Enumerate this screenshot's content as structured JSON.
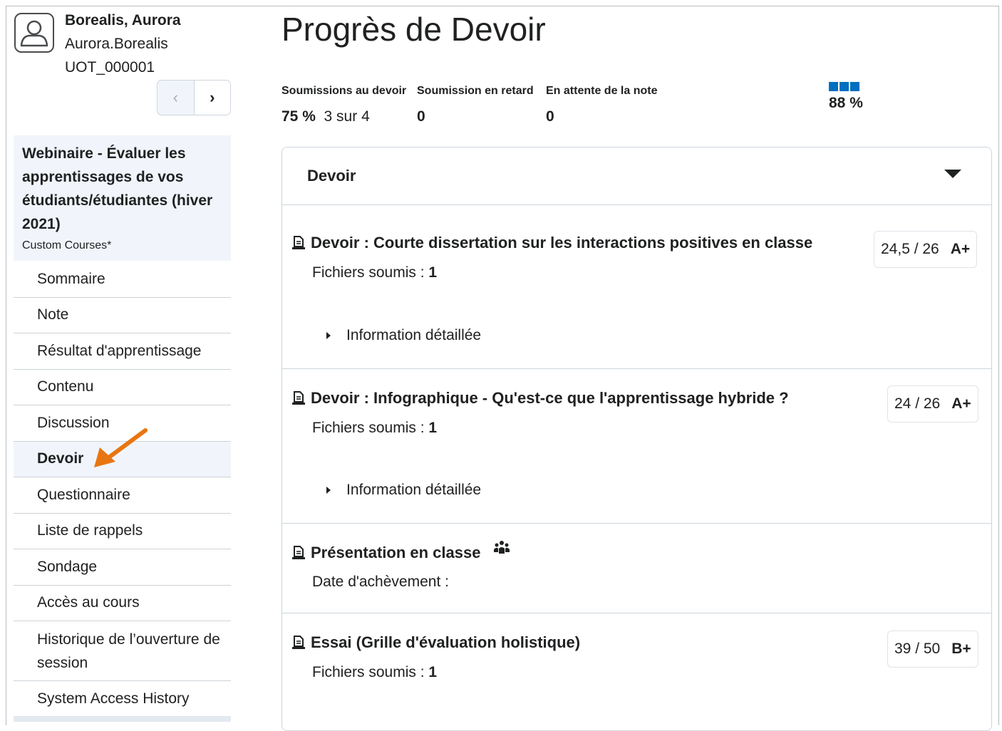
{
  "user": {
    "name": "Borealis, Aurora",
    "login": "Aurora.Borealis",
    "id": "UOT_000001"
  },
  "pager": {
    "prev": "‹",
    "next": "›"
  },
  "course": {
    "title_lines": [
      "Webinaire - Évaluer les",
      "apprentissages de vos",
      "étudiants/étudiantes (hiver",
      "2021)"
    ],
    "category": "Custom Courses*"
  },
  "nav": [
    "Sommaire",
    "Note",
    "Résultat d'apprentissage",
    "Contenu",
    "Discussion",
    "Devoir",
    "Questionnaire",
    "Liste de rappels",
    "Sondage",
    "Accès au cours",
    "Historique de l’ouverture de session",
    "System Access History"
  ],
  "page": {
    "title": "Progrès de Devoir"
  },
  "stats": {
    "submissions": {
      "label": "Soumissions au devoir",
      "percent": "75 %",
      "count": "3 sur 4"
    },
    "late": {
      "label": "Soumission en retard",
      "value": "0"
    },
    "pending": {
      "label": "En attente de la note",
      "value": "0"
    },
    "meter": {
      "label": "88 %",
      "fraction": 0.88
    }
  },
  "panel": {
    "title": "Devoir"
  },
  "items": [
    {
      "title": "Devoir : Courte dissertation sur les interactions positives en classe",
      "sub_label": "Fichiers soumis :",
      "sub_value": "1",
      "detail": "Information détaillée",
      "score": "24,5 / 26",
      "letter": "A+"
    },
    {
      "title": "Devoir : Infographique - Qu'est-ce que l'apprentissage hybride ?",
      "sub_label": "Fichiers soumis :",
      "sub_value": "1",
      "detail": "Information détaillée",
      "score": "24 / 26",
      "letter": "A+"
    },
    {
      "title": "Présentation en classe",
      "sub_label": "Date d'achèvement :",
      "sub_value": ""
    },
    {
      "title": "Essai (Grille d'évaluation holistique)",
      "sub_label": "Fichiers soumis :",
      "sub_value": "1",
      "score": "39 / 50",
      "letter": "B+"
    }
  ],
  "colors": {
    "accent": "#006fbf",
    "arrow": "#e87511",
    "selected_bg": "#f1f5fb"
  }
}
